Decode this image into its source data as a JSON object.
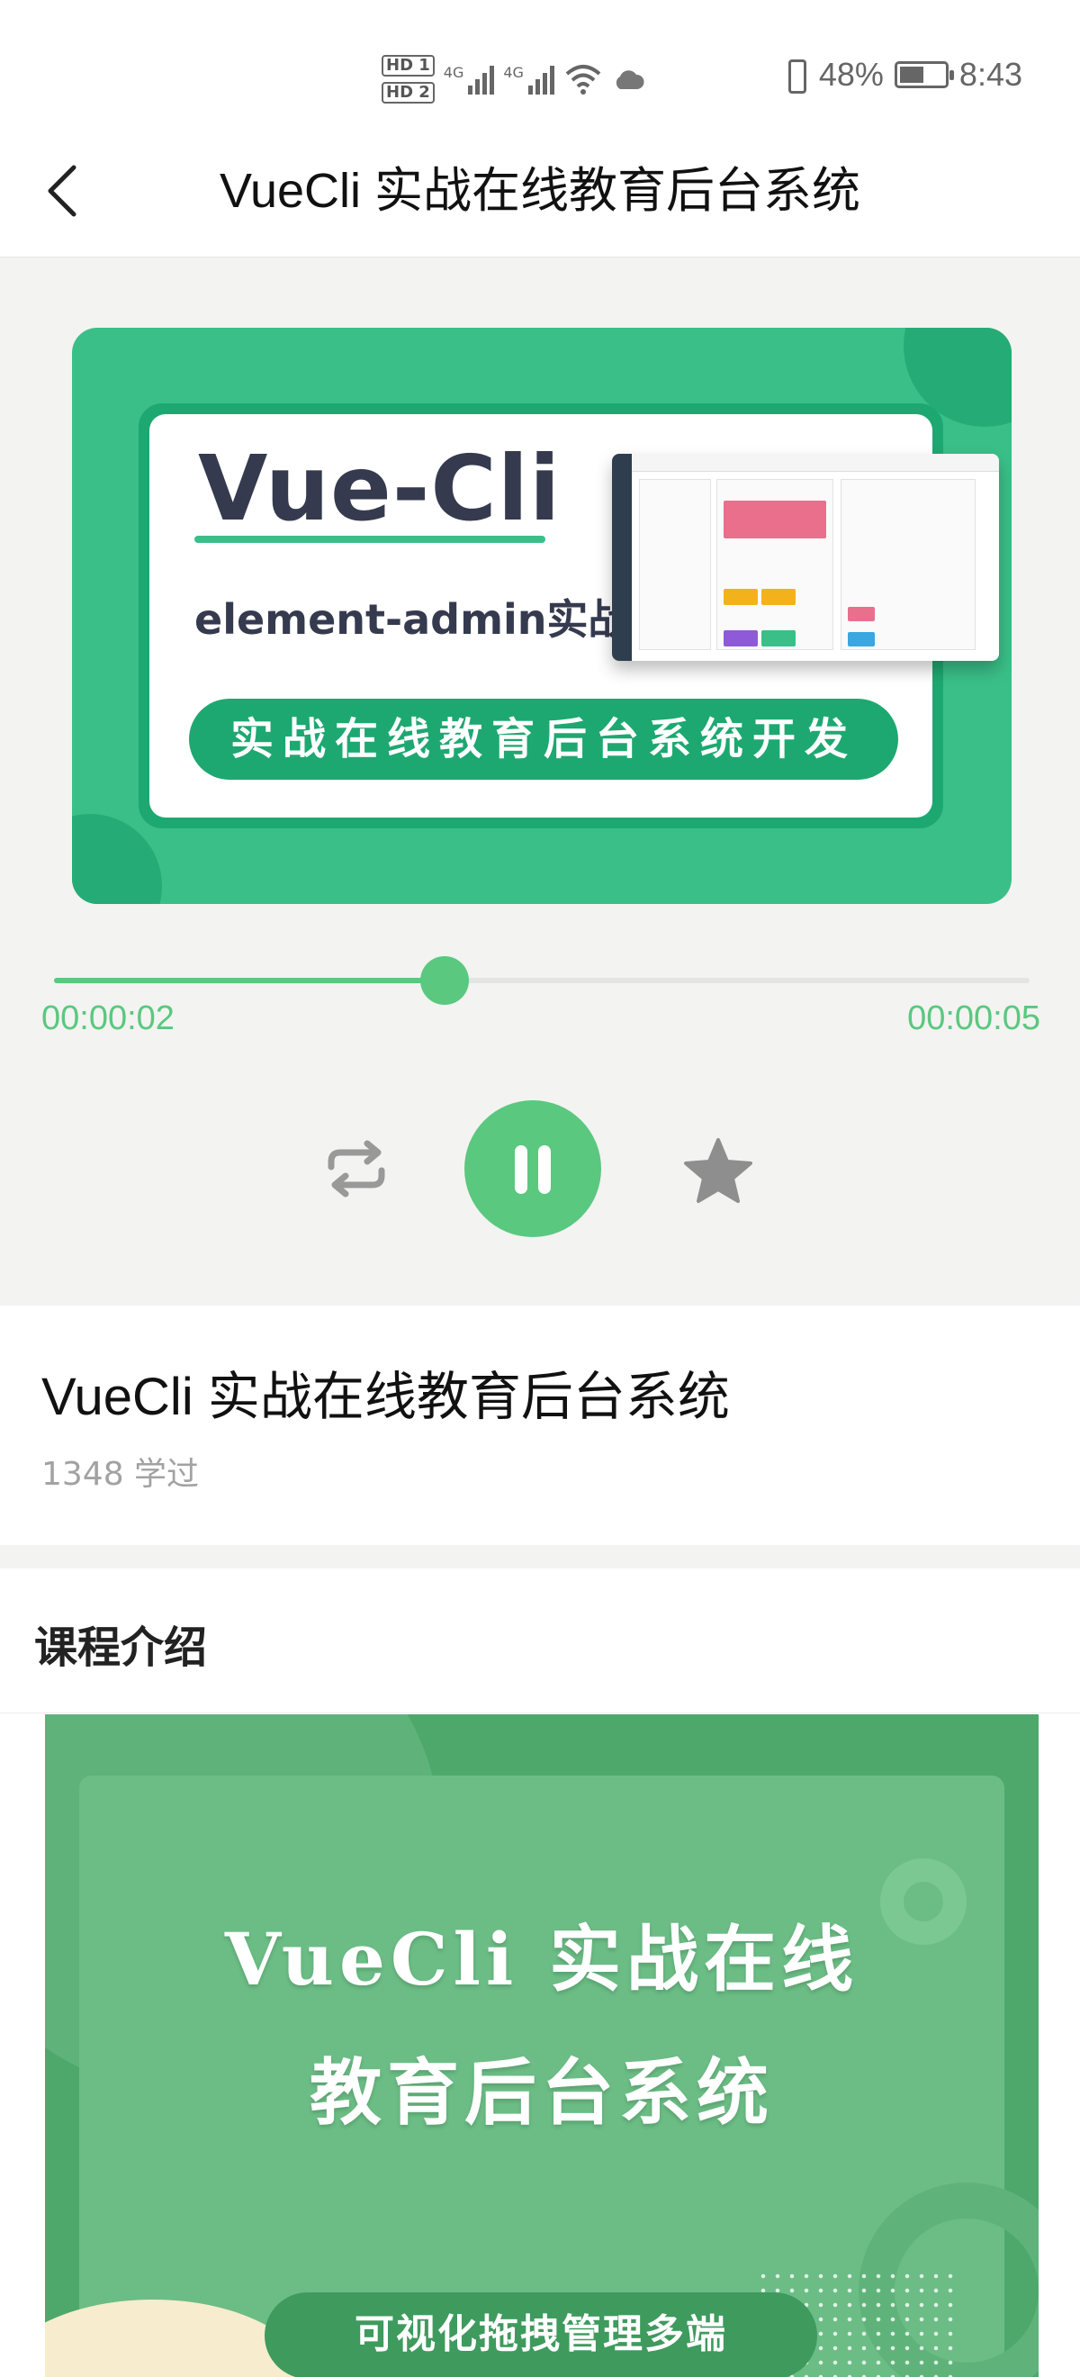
{
  "status_bar": {
    "hd1": "HD 1",
    "hd2": "HD 2",
    "signal1": "4G",
    "signal2": "4G",
    "battery": "48%",
    "time": "8:43"
  },
  "header": {
    "title": "VueCli 实战在线教育后台系统",
    "back_icon": "chevron-left-icon"
  },
  "cover": {
    "headline": "Vue-Cli",
    "subline": "element-admin实战",
    "pill": "实战在线教育后台系统开发",
    "accent": "#3abf88"
  },
  "player": {
    "current_time": "00:00:02",
    "total_time": "00:00:05",
    "progress": 0.4,
    "accent": "#5ac87f",
    "icons": [
      "loop-icon",
      "pause-icon",
      "star-icon"
    ]
  },
  "course": {
    "title": "VueCli 实战在线教育后台系统",
    "learners": "1348 学过"
  },
  "intro": {
    "heading": "课程介绍",
    "poster_line1": "VueCli 实战在线",
    "poster_line2": "教育后台系统",
    "poster_pill": "可视化拖拽管理多端"
  }
}
